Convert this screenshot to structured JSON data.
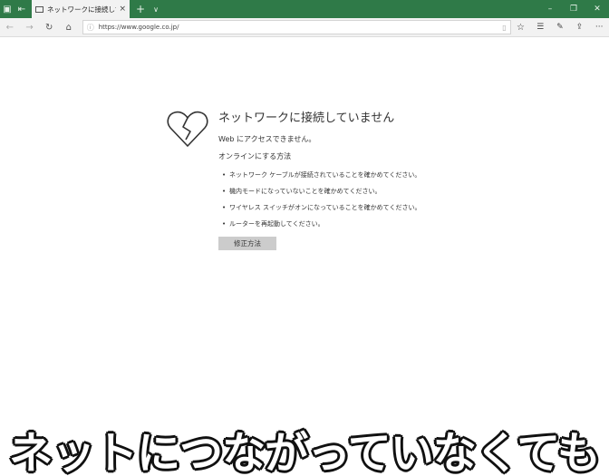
{
  "browser": {
    "tab_title": "ネットワークに接続していま",
    "tab_close": "×",
    "new_tab": "+",
    "tab_list": "∨",
    "window_buttons": {
      "minimize": "–",
      "restore": "❐",
      "close": "✕"
    },
    "nav": {
      "back": "←",
      "forward": "→",
      "refresh": "↻",
      "home": "⌂"
    },
    "address": {
      "info_icon": "ⓘ",
      "url": "https://www.google.co.jp/",
      "reading_icon": "▯"
    },
    "favorite": "☆",
    "toolbar": {
      "favorites_hub": "☰",
      "notes": "✎",
      "share": "⇪",
      "more": "···"
    },
    "accent_color": "#2f7a48"
  },
  "error_page": {
    "title": "ネットワークに接続していません",
    "subtitle": "Web にアクセスできません。",
    "how_to_heading": "オンラインにする方法",
    "steps": [
      "ネットワーク ケーブルが接続されていることを確かめてください。",
      "機内モードになっていないことを確かめてください。",
      "ワイヤレス スイッチがオンになっていることを確かめてください。",
      "ルーターを再起動してください。"
    ],
    "fix_button": "修正方法",
    "icon": "broken-heart-icon"
  },
  "caption": "ネットにつながっていなくても"
}
